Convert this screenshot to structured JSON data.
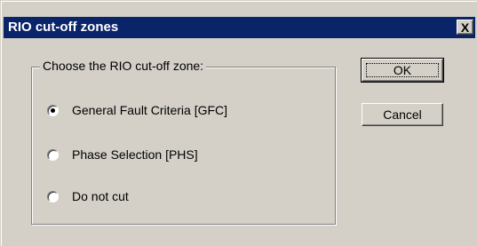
{
  "window": {
    "title": "RIO cut-off zones",
    "close_label": "X"
  },
  "group": {
    "legend": "Choose the RIO cut-off zone:",
    "options": [
      {
        "label": "General Fault Criteria [GFC]",
        "selected": true
      },
      {
        "label": "Phase Selection [PHS]",
        "selected": false
      },
      {
        "label": "Do not cut",
        "selected": false
      }
    ]
  },
  "buttons": {
    "ok_label": "OK",
    "cancel_label": "Cancel"
  },
  "colors": {
    "titlebar": "#0a246a",
    "face": "#d4d0c8"
  }
}
